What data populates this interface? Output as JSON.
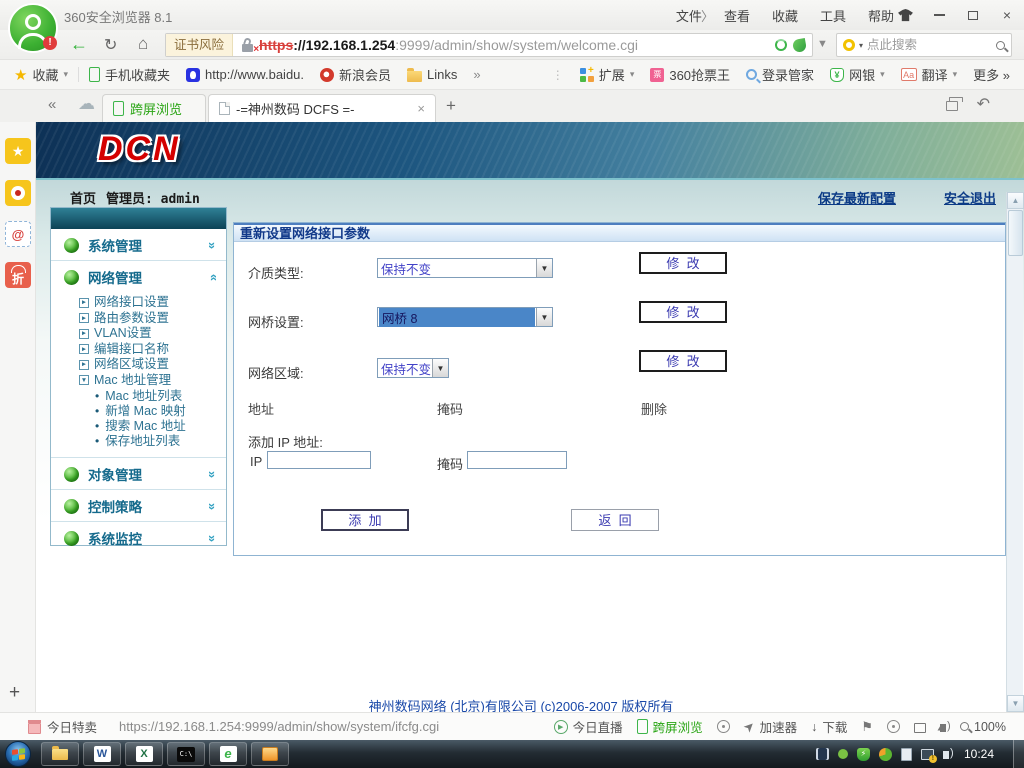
{
  "glyphs": {
    "gt": "〉",
    "back": "←",
    "refresh": "↻",
    "home": "⌂",
    "caret": "▾",
    "more": "»",
    "dots": "⋮",
    "plus": "+",
    "close": "×",
    "star": "★",
    "cloud": "☁",
    "collapse": "«",
    "undo": "↶",
    "chevrons": "»",
    "arrow_right": "►",
    "arrow_down": "▼",
    "bullet": "•",
    "up_small": "▲",
    "down_small": "▼",
    "down_arrow": "↓",
    "flag": "⚑",
    "play": "▶",
    "at": "@",
    "zhe": "折",
    "yen": "¥",
    "aa": "Aa",
    "ticket": "票",
    "bolt": "⚡",
    "bang": "!",
    "rocket": "➤"
  },
  "browser": {
    "title": "360安全浏览器 8.1",
    "menu": [
      "文件",
      "查看",
      "收藏",
      "工具",
      "帮助"
    ],
    "address": {
      "cert_badge": "证书风险",
      "protocol": "https",
      "host": "://192.168.1.254",
      "path": ":9999/admin/show/system/welcome.cgi"
    },
    "search_placeholder": "点此搜索",
    "bookmarks_left": {
      "fav": "收藏",
      "mobile": "手机收藏夹",
      "baidu": "http://www.baidu.",
      "sina": "新浪会员",
      "links": "Links"
    },
    "bookmarks_right": {
      "ext": "扩展",
      "qiangpiao": "360抢票王",
      "login": "登录管家",
      "bank": "网银",
      "trans": "翻译",
      "more": "更多 »"
    },
    "tabs": {
      "tab1": "跨屏浏览",
      "tab2": "-=神州数码 DCFS =-"
    }
  },
  "page": {
    "logo": "DCN",
    "home_label": "首页",
    "admin_label": "管理员: admin",
    "save_link": "保存最新配置",
    "logout_link": "安全退出",
    "sidebar": {
      "sections": [
        "系统管理",
        "网络管理",
        "对象管理",
        "控制策略",
        "系统监控"
      ],
      "network_items": [
        "网络接口设置",
        "路由参数设置",
        "VLAN设置",
        "编辑接口名称",
        "网络区域设置",
        "Mac 地址管理"
      ],
      "mac_items": [
        "Mac 地址列表",
        "新增 Mac 映射",
        "搜索 Mac 地址",
        "保存地址列表"
      ]
    },
    "panel": {
      "title": "重新设置网络接口参数",
      "rows": [
        {
          "label": "介质类型:",
          "value": "保持不变",
          "button": "修  改"
        },
        {
          "label": "网桥设置:",
          "value": "网桥 8",
          "button": "修  改"
        },
        {
          "label": "网络区域:",
          "value": "保持不变",
          "button": "修  改"
        }
      ],
      "table_headers": [
        "地址",
        "掩码",
        "删除"
      ],
      "add_ip_label": "添加 IP 地址:",
      "ip_label": "IP",
      "mask_label": "掩码",
      "add_button": "添  加",
      "back_button": "返  回"
    },
    "footer": "神州数码网络 (北京)有限公司 (c)2006-2007 版权所有"
  },
  "statusbar": {
    "deal": "今日特卖",
    "url": "https://192.168.1.254:9999/admin/show/system/ifcfg.cgi",
    "live": "今日直播",
    "cross_screen": "跨屏浏览",
    "accelerator": "加速器",
    "download": "下载",
    "zoom": "100%"
  },
  "taskbar": {
    "clock": "10:24",
    "cmd_label": "C:\\",
    "word_label": "W",
    "excel_label": "X",
    "browser_label": "e"
  },
  "colors": {
    "accent_green": "#2aa515",
    "brand_red": "#d40000",
    "link_blue": "#0b3a86",
    "menu_teal": "#156a8c",
    "select_highlight": "#4a86c8"
  }
}
